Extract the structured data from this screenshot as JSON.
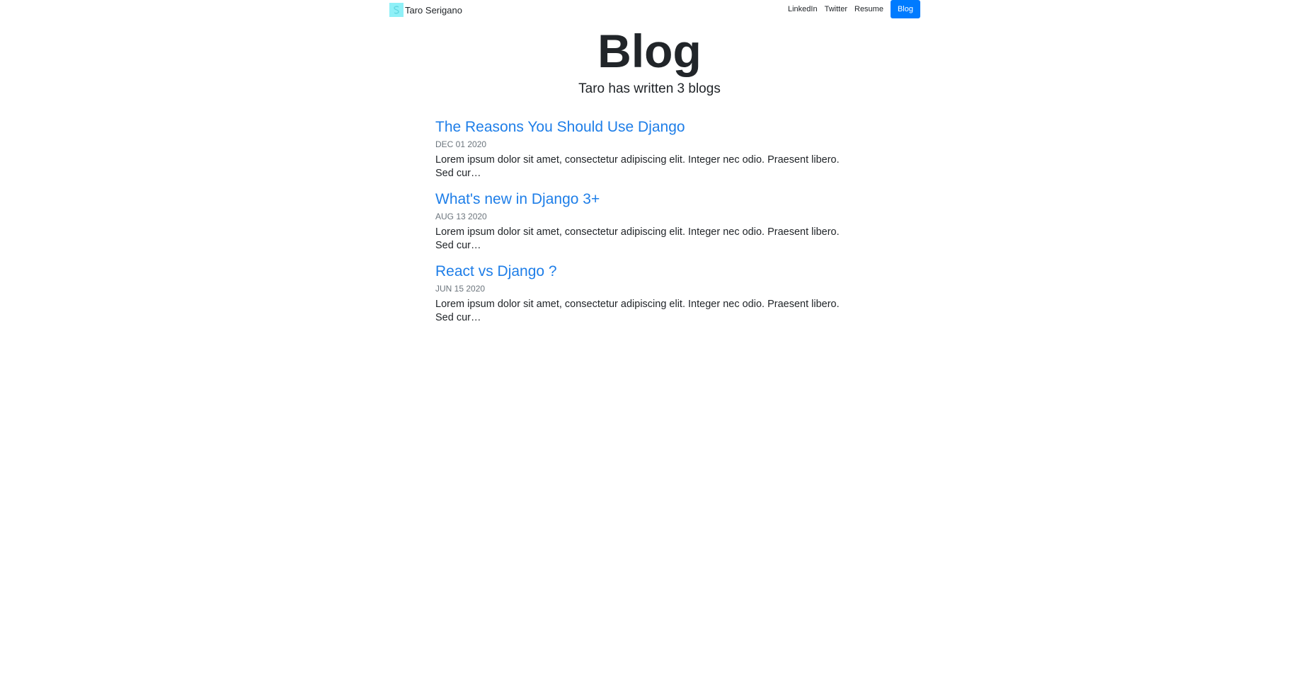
{
  "navbar": {
    "brand_name": "Taro Serigano",
    "brand_icon": "logo-icon",
    "links": [
      {
        "label": "LinkedIn"
      },
      {
        "label": "Twitter"
      },
      {
        "label": "Resume"
      },
      {
        "label": "Blog",
        "active": true
      }
    ]
  },
  "hero": {
    "title": "Blog",
    "subtitle": "Taro has written 3 blogs"
  },
  "posts": [
    {
      "title": "The Reasons You Should Use Django",
      "date": "DEC 01 2020",
      "excerpt": "Lorem ipsum dolor sit amet, consectetur adipiscing elit. Integer nec odio. Praesent libero. Sed cur…"
    },
    {
      "title": "What's new in Django 3+",
      "date": "AUG 13 2020",
      "excerpt": "Lorem ipsum dolor sit amet, consectetur adipiscing elit. Integer nec odio. Praesent libero. Sed cur…"
    },
    {
      "title": "React vs Django ?",
      "date": "JUN 15 2020",
      "excerpt": "Lorem ipsum dolor sit amet, consectetur adipiscing elit. Integer nec odio. Praesent libero. Sed cur…"
    }
  ],
  "colors": {
    "accent": "#007bff",
    "link": "#1e7ee8",
    "logo_bg": "#8ff0f7",
    "muted": "#6c757d"
  }
}
